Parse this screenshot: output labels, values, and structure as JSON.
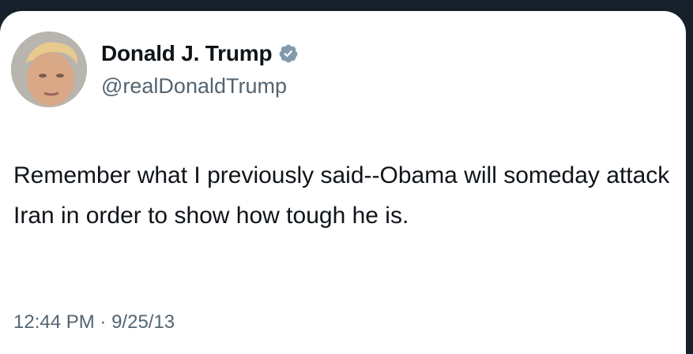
{
  "tweet": {
    "author": {
      "display_name": "Donald J. Trump",
      "handle": "@realDonaldTrump",
      "verified_icon": "verified-badge-icon",
      "verified_color": "#829aab"
    },
    "text": "Remember what I previously said--Obama will someday attack Iran in order to show how tough he is.",
    "time": "12:44 PM",
    "separator": "·",
    "date": "9/25/13"
  }
}
